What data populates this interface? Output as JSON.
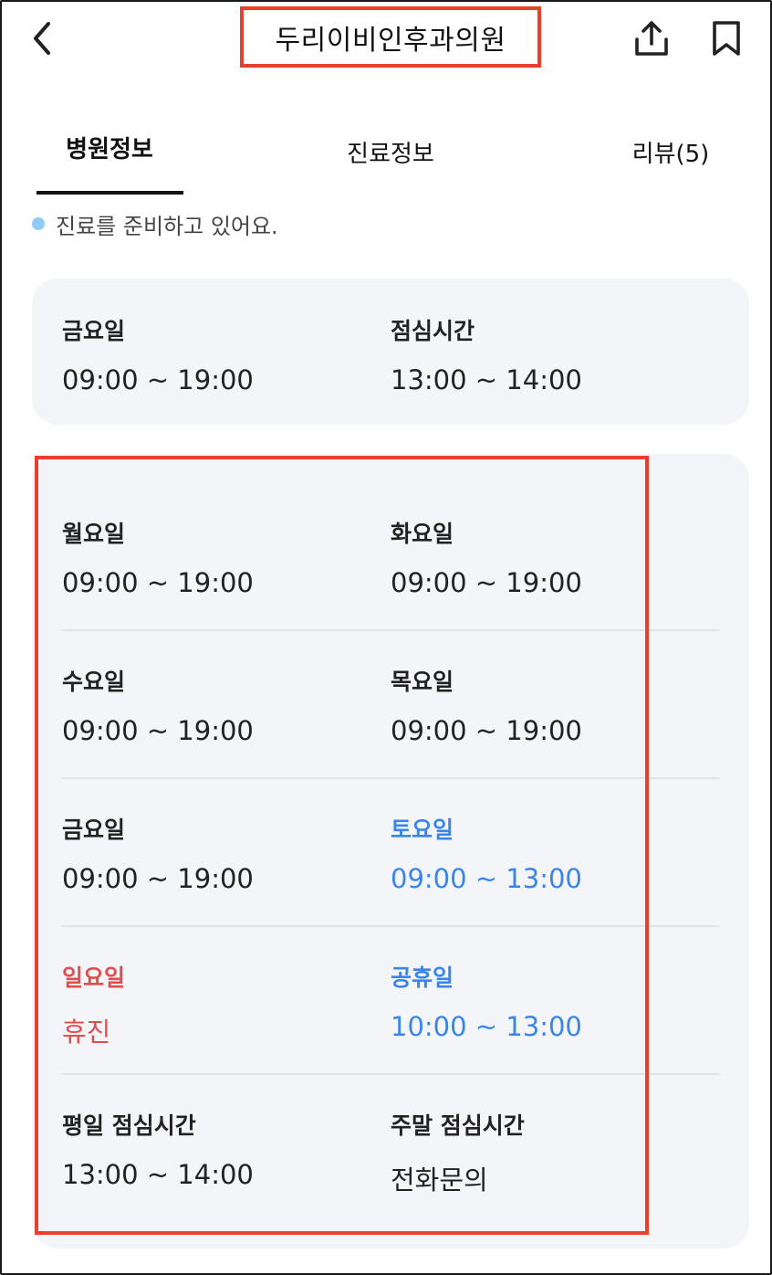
{
  "header": {
    "title": "두리이비인후과의원",
    "back_icon": "chevron-left-icon",
    "share_icon": "share-icon",
    "bookmark_icon": "bookmark-icon"
  },
  "tabs": [
    {
      "label": "병원정보",
      "active": true
    },
    {
      "label": "진료정보",
      "active": false
    },
    {
      "label": "리뷰(5)",
      "active": false
    }
  ],
  "status": {
    "text": "진료를 준비하고 있어요.",
    "dot_color": "#90caf9"
  },
  "today": {
    "day_label": "금요일",
    "day_hours": "09:00 ~ 19:00",
    "lunch_label": "점심시간",
    "lunch_hours": "13:00 ~ 14:00"
  },
  "schedule": {
    "mon": {
      "label": "월요일",
      "hours": "09:00 ~ 19:00"
    },
    "tue": {
      "label": "화요일",
      "hours": "09:00 ~ 19:00"
    },
    "wed": {
      "label": "수요일",
      "hours": "09:00 ~ 19:00"
    },
    "thu": {
      "label": "목요일",
      "hours": "09:00 ~ 19:00"
    },
    "fri": {
      "label": "금요일",
      "hours": "09:00 ~ 19:00"
    },
    "sat": {
      "label": "토요일",
      "hours": "09:00 ~ 13:00"
    },
    "sun": {
      "label": "일요일",
      "hours": "휴진"
    },
    "holiday": {
      "label": "공휴일",
      "hours": "10:00 ~ 13:00"
    },
    "weekday_lunch": {
      "label": "평일 점심시간",
      "hours": "13:00 ~ 14:00"
    },
    "weekend_lunch": {
      "label": "주말 점심시간",
      "hours": "전화문의"
    }
  },
  "colors": {
    "accent_blue": "#3a86e8",
    "closed_red": "#e04d4d",
    "highlight_red": "#e8402c",
    "card_bg": "#f4f5f8"
  }
}
